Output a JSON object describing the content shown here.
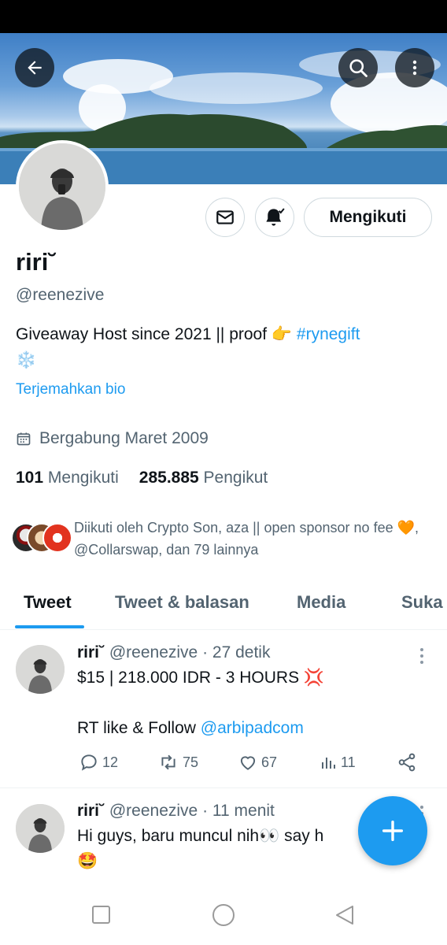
{
  "profile": {
    "name": "riri˘",
    "handle": "@reenezive",
    "bio_text": "Giveaway Host since 2021 || proof 👉 ",
    "bio_hashtag": "#rynegift",
    "bio_emoji": "❄️",
    "translate_bio": "Terjemahkan bio",
    "joined": "Bergabung Maret 2009",
    "following_count": "101",
    "following_label": "Mengikuti",
    "followers_count": "285.885",
    "followers_label": "Pengikut",
    "followed_by": "Diikuti oleh Crypto Son, aza || open sponsor no fee 🧡, @Collarswap, dan 79 lainnya",
    "follow_button": "Mengikuti"
  },
  "tabs": [
    "Tweet",
    "Tweet & balasan",
    "Media",
    "Suka"
  ],
  "tweets": [
    {
      "name": "riri˘",
      "handle": "@reenezive",
      "time": "· 27 detik",
      "line1": "$15 | 218.000 IDR - 3 HOURS 💢",
      "line2": "RT like & Follow ",
      "mention": "@arbipadcom",
      "replies": "12",
      "retweets": "75",
      "likes": "67",
      "views": "11"
    },
    {
      "name": "riri˘",
      "handle": "@reenezive",
      "time": "· 11 menit",
      "line1": "Hi guys, baru muncul nih👀 say h",
      "line2": "🤩"
    }
  ],
  "icons": {
    "back": "back-arrow-icon",
    "search": "search-icon",
    "more": "more-vertical-icon",
    "message": "mail-icon",
    "notify": "bell-icon",
    "calendar": "calendar-icon",
    "compose": "plus-icon"
  },
  "colors": {
    "accent": "#1d9bf0",
    "text": "#0f1419",
    "muted": "#536471"
  }
}
